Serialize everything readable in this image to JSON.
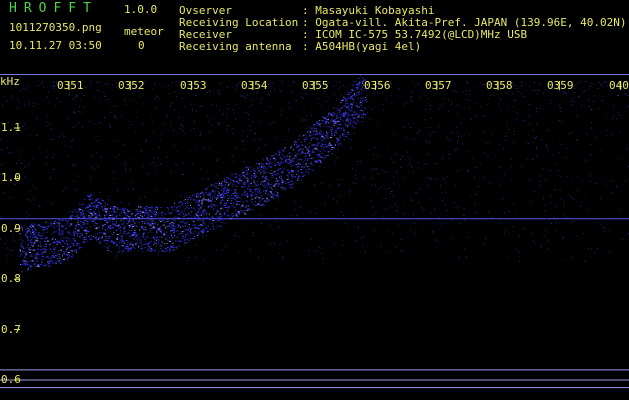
{
  "app": {
    "title": "HROFFT",
    "version": "1.0.0"
  },
  "file": {
    "name": "1011270350.png",
    "datetime": "10.11.27 03:50"
  },
  "meteor": {
    "label": "meteor",
    "count": "0"
  },
  "info": [
    {
      "key": "Ovserver",
      "value": ": Masayuki Kobayashi"
    },
    {
      "key": "Receiving Location",
      "value": ": Ogata-vill. Akita-Pref. JAPAN (139.96E, 40.02N)"
    },
    {
      "key": "Receiver",
      "value": ": ICOM IC-575 53.7492(@LCD)MHz USB"
    },
    {
      "key": "Receiving antenna",
      "value": ": A504HB(yagi 4el)"
    }
  ],
  "chart_data": {
    "type": "heatmap",
    "ylabel": "kHz",
    "y_ticks": [
      "1.1",
      "1.0",
      "0.9",
      "0.8",
      "0.7",
      "0.6"
    ],
    "x_ticks": [
      "0351",
      "0352",
      "0353",
      "0354",
      "0355",
      "0356",
      "0357",
      "0358",
      "0359",
      "0400"
    ],
    "ylim": [
      0.55,
      1.2
    ],
    "time_range": [
      "03:50",
      "04:00"
    ],
    "trail": [
      {
        "t": 0.0,
        "f": 0.86
      },
      {
        "t": 0.8,
        "f": 0.88
      },
      {
        "t": 1.2,
        "f": 0.93
      },
      {
        "t": 1.5,
        "f": 0.9
      },
      {
        "t": 2.5,
        "f": 0.9
      },
      {
        "t": 3.5,
        "f": 0.96
      },
      {
        "t": 4.5,
        "f": 1.02
      },
      {
        "t": 5.3,
        "f": 1.1
      },
      {
        "t": 5.8,
        "f": 1.17
      }
    ],
    "carrier_lines": [
      0.92,
      0.62,
      0.6,
      0.585
    ],
    "colors": {
      "signal": "#3a3aff",
      "carrier": "#5555ee",
      "text": "#e8e866",
      "title": "#4fd24f",
      "background": "#000000"
    }
  }
}
